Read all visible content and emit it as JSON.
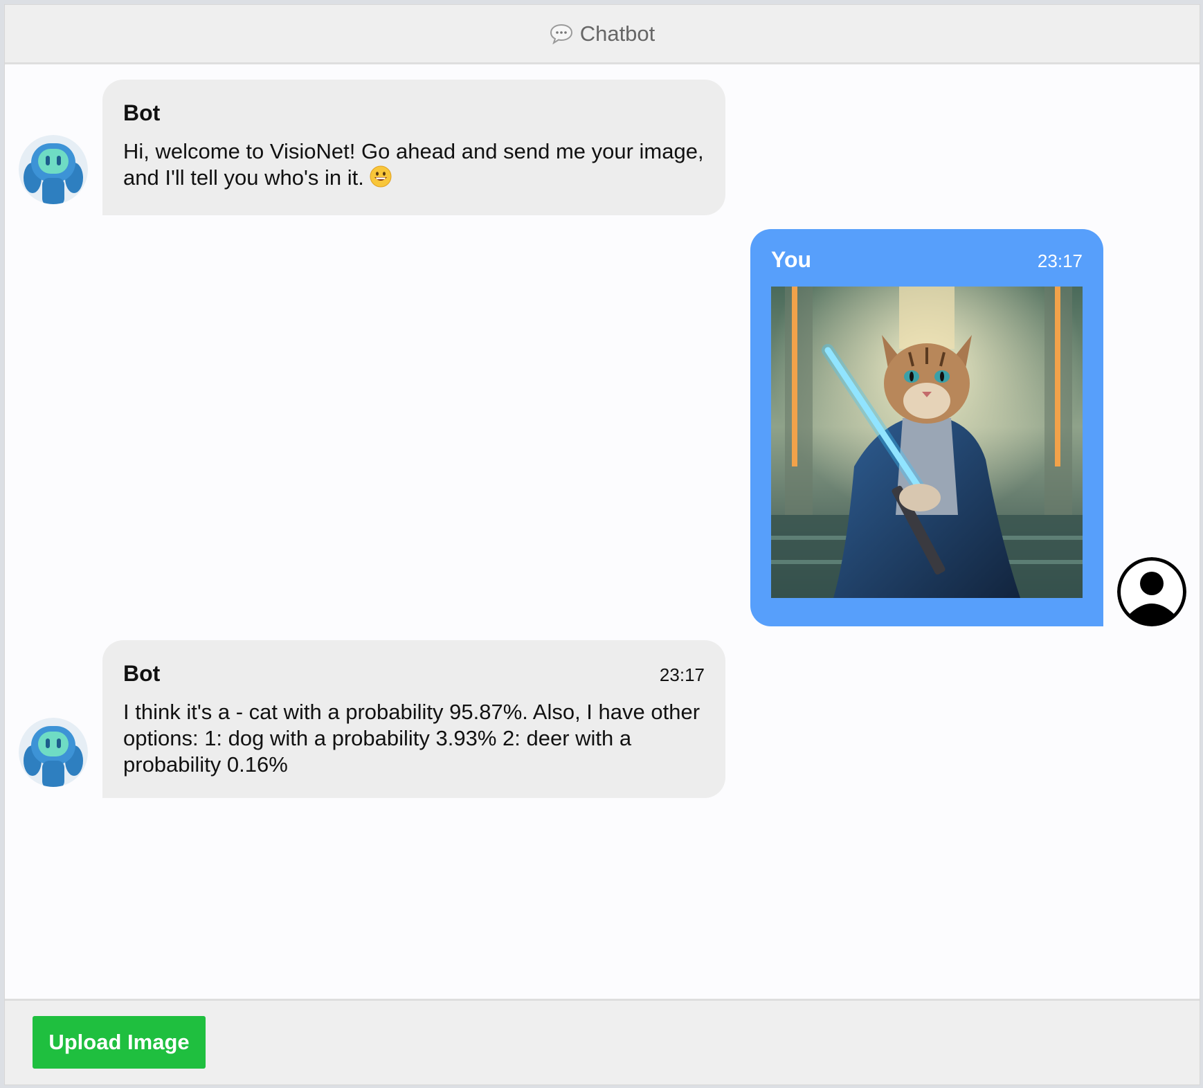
{
  "header": {
    "title": "Chatbot",
    "icon": "chat-bubble-icon"
  },
  "messages": [
    {
      "sender": "Bot",
      "time": "",
      "text": "Hi, welcome to VisioNet! Go ahead and send me your image, and I'll tell you who's in it.",
      "emoji": "grinning-face-icon"
    },
    {
      "sender": "You",
      "time": "23:17",
      "image": "cat-jedi-lightsaber-image"
    },
    {
      "sender": "Bot",
      "time": "23:17",
      "text": "I think it's a - cat with a probability 95.87%. Also, I have other options: 1: dog with a probability 3.93% 2: deer with a probability 0.16%"
    }
  ],
  "footer": {
    "upload_label": "Upload Image"
  },
  "colors": {
    "user_bubble": "#579ffb",
    "bot_bubble": "#ededed",
    "upload_button": "#1fbf3f"
  }
}
